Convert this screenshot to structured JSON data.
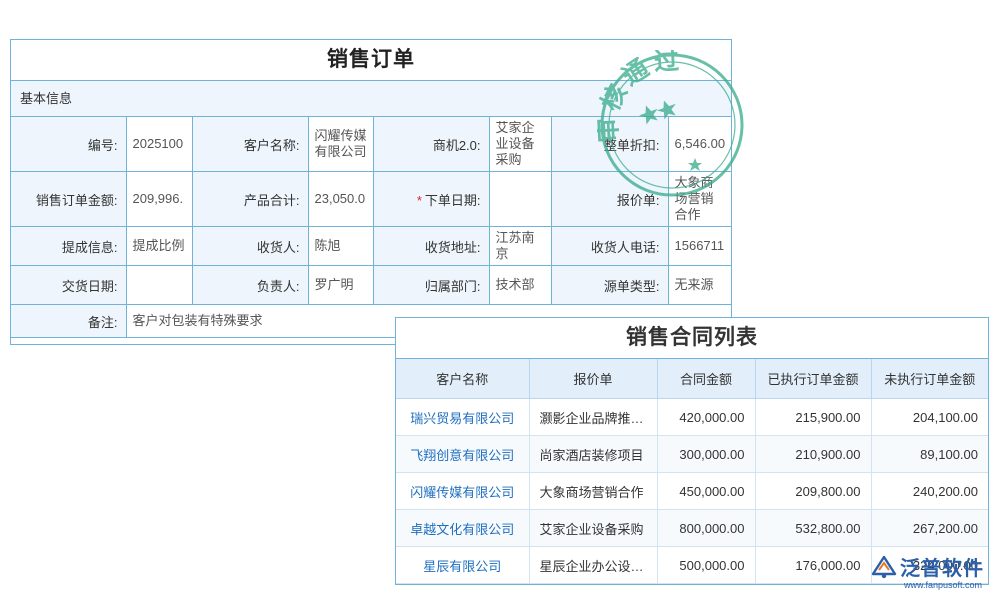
{
  "order": {
    "title": "销售订单",
    "section": "基本信息",
    "rows": [
      [
        {
          "label": "编号:",
          "value": "2025100"
        },
        {
          "label": "客户名称:",
          "value": "闪耀传媒有限公司"
        },
        {
          "label": "商机2.0:",
          "value": "艾家企业设备采购"
        },
        {
          "label": "整单折扣:",
          "value": "6,546.00"
        }
      ],
      [
        {
          "label": "销售订单金额:",
          "value": "209,996."
        },
        {
          "label": "产品合计:",
          "value": "23,050.0"
        },
        {
          "label": "下单日期:",
          "value": "",
          "required": true
        },
        {
          "label": "报价单:",
          "value": "大象商场营销合作"
        }
      ],
      [
        {
          "label": "提成信息:",
          "value": "提成比例"
        },
        {
          "label": "收货人:",
          "value": "陈旭"
        },
        {
          "label": "收货地址:",
          "value": "江苏南京"
        },
        {
          "label": "收货人电话:",
          "value": "1566711"
        }
      ],
      [
        {
          "label": "交货日期:",
          "value": ""
        },
        {
          "label": "负责人:",
          "value": "罗广明"
        },
        {
          "label": "归属部门:",
          "value": "技术部"
        },
        {
          "label": "源单类型:",
          "value": "无来源"
        }
      ]
    ],
    "remark": {
      "label": "备注:",
      "value": "客户对包装有特殊要求"
    },
    "stamp_text": "审核通过",
    "stamp_color": "#3dae8e"
  },
  "contracts": {
    "title": "销售合同列表",
    "columns": [
      "客户名称",
      "报价单",
      "合同金额",
      "已执行订单金额",
      "未执行订单金额"
    ],
    "rows": [
      [
        "瑞兴贸易有限公司",
        "灏影企业品牌推广项目",
        "420,000.00",
        "215,900.00",
        "204,100.00"
      ],
      [
        "飞翔创意有限公司",
        "尚家酒店装修项目",
        "300,000.00",
        "210,900.00",
        "89,100.00"
      ],
      [
        "闪耀传媒有限公司",
        "大象商场营销合作",
        "450,000.00",
        "209,800.00",
        "240,200.00"
      ],
      [
        "卓越文化有限公司",
        "艾家企业设备采购",
        "800,000.00",
        "532,800.00",
        "267,200.00"
      ],
      [
        "星辰有限公司",
        "星辰企业办公设备采购",
        "500,000.00",
        "176,000.00",
        "324,000.00"
      ]
    ]
  },
  "brand": {
    "name": "泛普软件",
    "url": "www.fanpusoft.com",
    "color": "#2b5fa8",
    "icon": "fanpu-logo-icon"
  },
  "colors": {
    "border": "#6fb3d8",
    "label_bg": "#eef5fc",
    "header_bg": "#e2eef9",
    "link": "#1f6fbf",
    "required": "#e02020"
  }
}
